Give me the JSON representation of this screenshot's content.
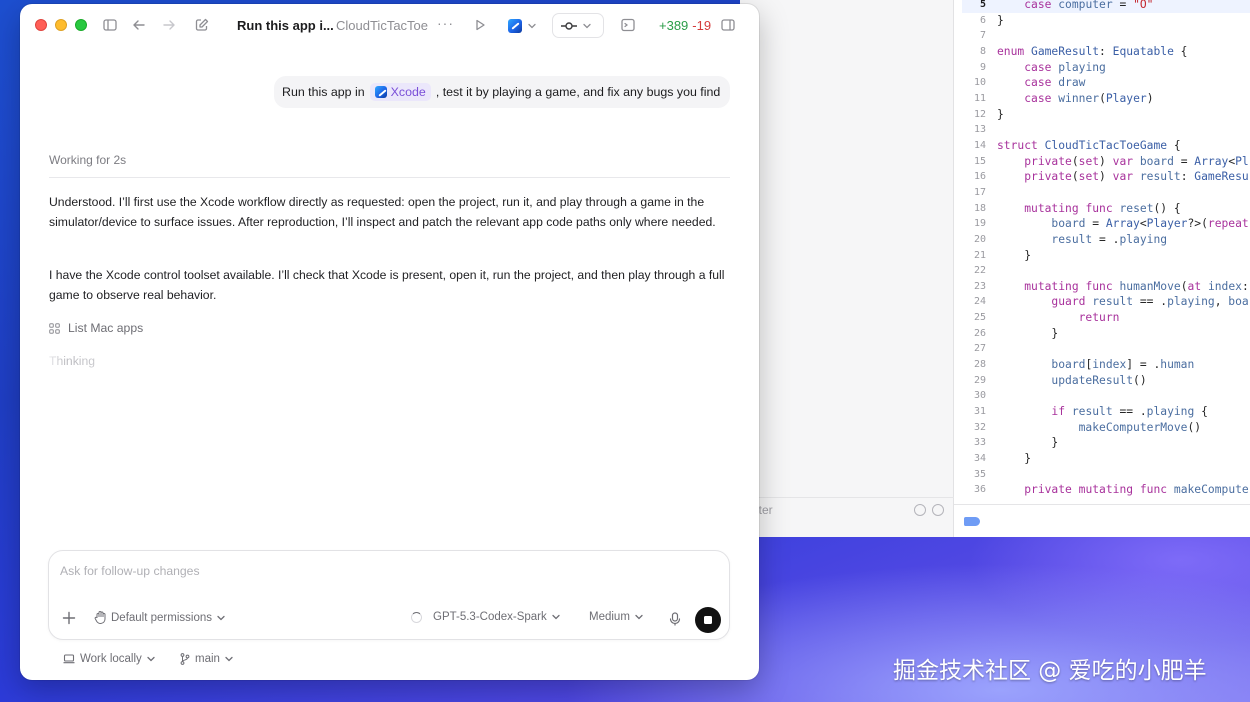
{
  "titlebar": {
    "title": "Run this app i...",
    "project": "CloudTicTacToe",
    "more": "···",
    "diff_added": "+389",
    "diff_removed": "-19"
  },
  "chat": {
    "user_message_before": "Run this app in",
    "user_message_chip": "Xcode",
    "user_message_after": ", test it by playing a game, and fix any bugs you find",
    "working_status": "Working for 2s",
    "paragraph_1": "Understood. I’ll first use the Xcode workflow directly as requested: open the project, run it, and play through a game in the simulator/device to surface issues. After reproduction, I’ll inspect and patch the relevant app code paths only where needed.",
    "paragraph_2": "I have the Xcode control toolset available. I’ll check that Xcode is present, open it, run the project, and then play through a full game to observe real behavior.",
    "tool_call": "List Mac apps",
    "thinking": "Thinking"
  },
  "composer": {
    "placeholder": "Ask for follow-up changes",
    "permissions": "Default permissions",
    "model": "GPT-5.3-Codex-Spark",
    "reasoning": "Medium"
  },
  "footer": {
    "location": "Work locally",
    "branch": "main"
  },
  "xcode": {
    "filter_text": "lter",
    "code_lines": [
      {
        "n": "5",
        "t": "    case computer = \"O\"",
        "active": true
      },
      {
        "n": "6",
        "t": "}"
      },
      {
        "n": "7",
        "t": ""
      },
      {
        "n": "8",
        "t": "enum GameResult: Equatable {"
      },
      {
        "n": "9",
        "t": "    case playing"
      },
      {
        "n": "10",
        "t": "    case draw"
      },
      {
        "n": "11",
        "t": "    case winner(Player)"
      },
      {
        "n": "12",
        "t": "}"
      },
      {
        "n": "13",
        "t": ""
      },
      {
        "n": "14",
        "t": "struct CloudTicTacToeGame {"
      },
      {
        "n": "15",
        "t": "    private(set) var board = Array<Pl"
      },
      {
        "n": "16",
        "t": "    private(set) var result: GameResu"
      },
      {
        "n": "17",
        "t": ""
      },
      {
        "n": "18",
        "t": "    mutating func reset() {"
      },
      {
        "n": "19",
        "t": "        board = Array<Player?>(repeat"
      },
      {
        "n": "20",
        "t": "        result = .playing"
      },
      {
        "n": "21",
        "t": "    }"
      },
      {
        "n": "22",
        "t": ""
      },
      {
        "n": "23",
        "t": "    mutating func humanMove(at index:"
      },
      {
        "n": "24",
        "t": "        guard result == .playing, boa"
      },
      {
        "n": "25",
        "t": "            return"
      },
      {
        "n": "26",
        "t": "        }"
      },
      {
        "n": "27",
        "t": ""
      },
      {
        "n": "28",
        "t": "        board[index] = .human"
      },
      {
        "n": "29",
        "t": "        updateResult()"
      },
      {
        "n": "30",
        "t": ""
      },
      {
        "n": "31",
        "t": "        if result == .playing {"
      },
      {
        "n": "32",
        "t": "            makeComputerMove()"
      },
      {
        "n": "33",
        "t": "        }"
      },
      {
        "n": "34",
        "t": "    }"
      },
      {
        "n": "35",
        "t": ""
      },
      {
        "n": "36",
        "t": "    private mutating func makeCompute"
      }
    ]
  },
  "watermark": "掘金技术社区 @ 爱吃的小肥羊",
  "colors": {
    "accent_purple": "#7a4fd8",
    "diff_green": "#2a9d48",
    "diff_red": "#d53b3b",
    "close": "#ff5f57",
    "minimize": "#febc2e",
    "zoom": "#28c840"
  }
}
